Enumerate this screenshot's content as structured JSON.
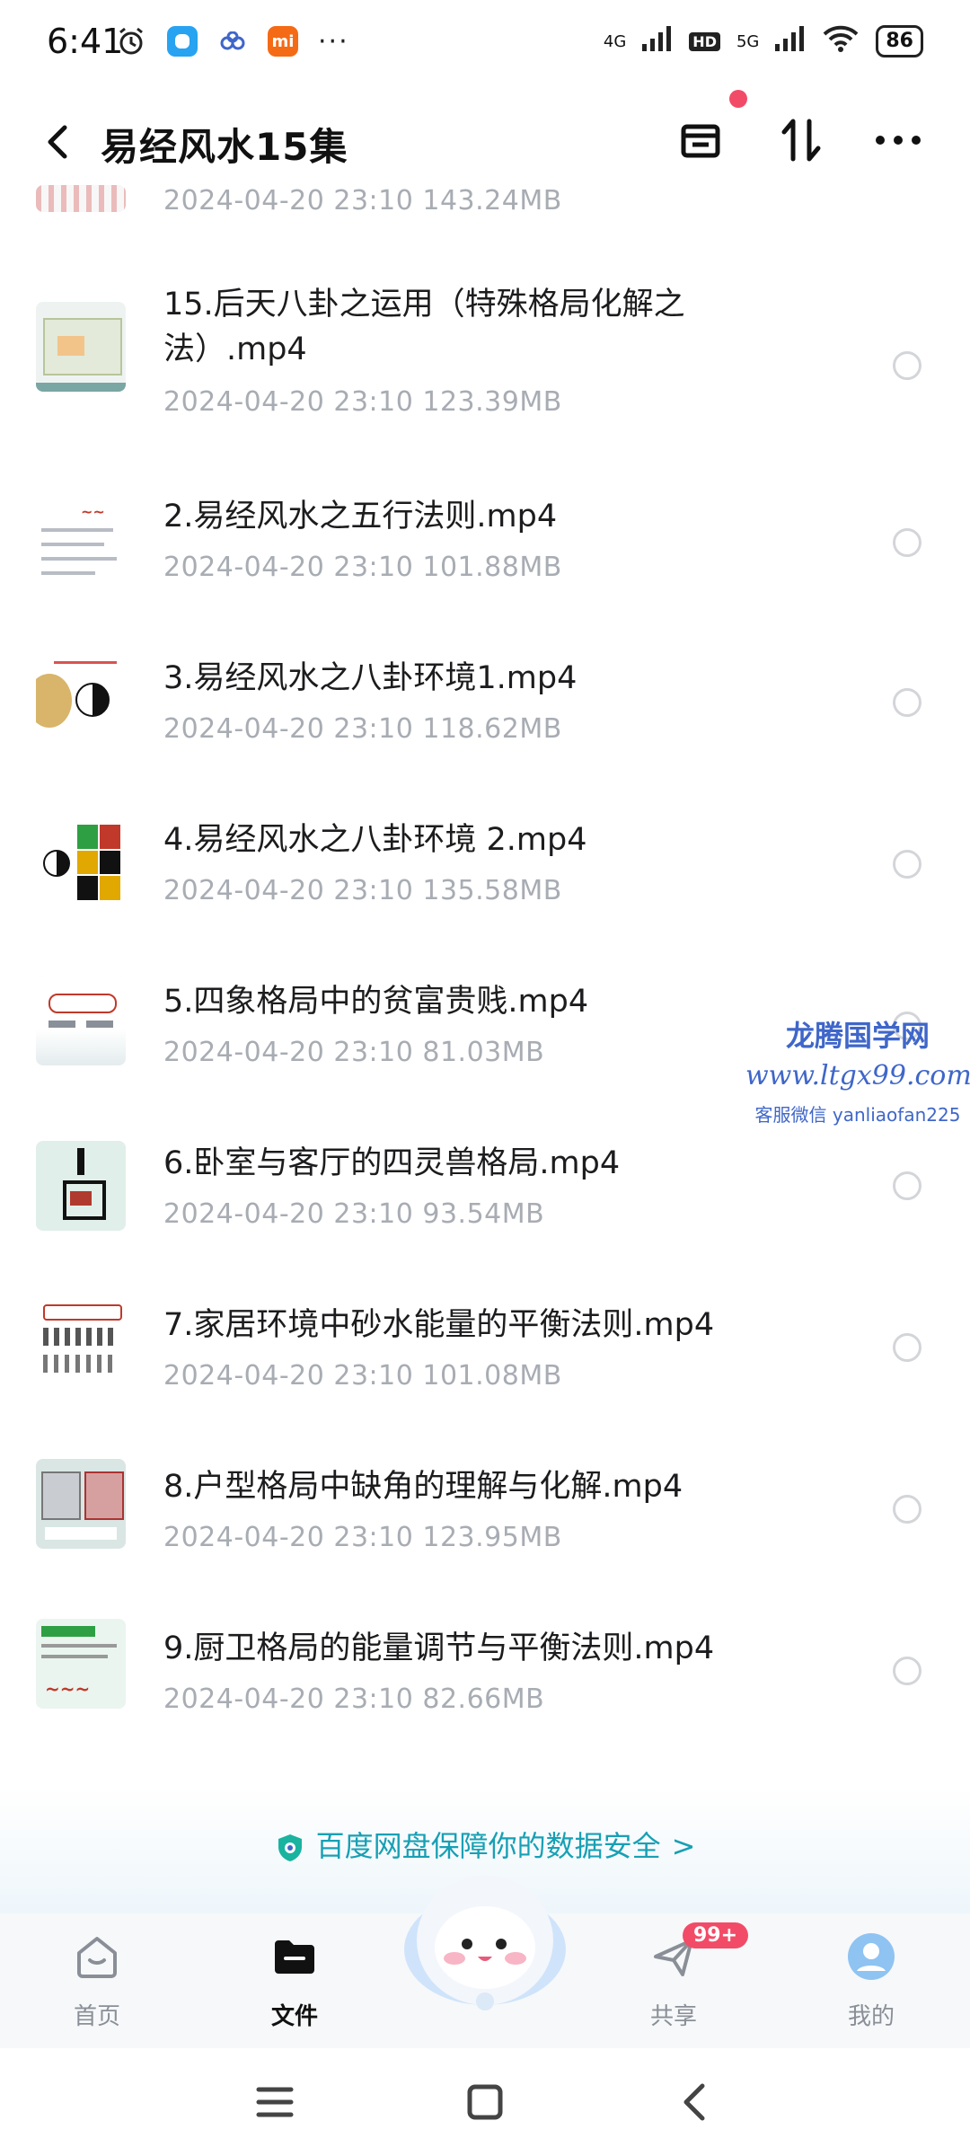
{
  "status_bar": {
    "time": "6:41",
    "network1": "4G",
    "hd": "HD",
    "network2": "5G",
    "battery": "86"
  },
  "header": {
    "title": "易经风水15集",
    "back_icon": "chevron-left-icon",
    "actions": [
      "window-icon",
      "sort-icon",
      "more-icon"
    ]
  },
  "files": [
    {
      "name": "",
      "meta": "2024-04-20  23:10  143.24MB"
    },
    {
      "name": "15.后天八卦之运用（特殊格局化解之法）.mp4",
      "meta": "2024-04-20  23:10  123.39MB"
    },
    {
      "name": "2.易经风水之五行法则.mp4",
      "meta": "2024-04-20  23:10  101.88MB"
    },
    {
      "name": "3.易经风水之八卦环境1.mp4",
      "meta": "2024-04-20  23:10  118.62MB"
    },
    {
      "name": "4.易经风水之八卦环境 2.mp4",
      "meta": "2024-04-20  23:10  135.58MB"
    },
    {
      "name": "5.四象格局中的贫富贵贱.mp4",
      "meta": "2024-04-20  23:10  81.03MB"
    },
    {
      "name": "6.卧室与客厅的四灵兽格局.mp4",
      "meta": "2024-04-20  23:10  93.54MB"
    },
    {
      "name": "7.家居环境中砂水能量的平衡法则.mp4",
      "meta": "2024-04-20  23:10  101.08MB"
    },
    {
      "name": "8.户型格局中缺角的理解与化解.mp4",
      "meta": "2024-04-20  23:10  123.95MB"
    },
    {
      "name": "9.厨卫格局的能量调节与平衡法则.mp4",
      "meta": "2024-04-20  23:10  82.66MB"
    }
  ],
  "watermark": {
    "line1": "龙腾国学网",
    "line2": "www.ltgx99.com",
    "line3": "客服微信 yanliaofan225"
  },
  "banner": {
    "text": "百度网盘保障你的数据安全",
    "arrow": ">"
  },
  "bottom_nav": {
    "items": [
      {
        "label": "首页",
        "icon": "home-icon"
      },
      {
        "label": "文件",
        "icon": "folder-icon"
      },
      {
        "label": "共享",
        "icon": "share-icon"
      },
      {
        "label": "我的",
        "icon": "profile-icon"
      }
    ],
    "badge": "99+"
  },
  "colors": {
    "accent": "#17a0b4",
    "badge": "#f24b67",
    "meta_text": "#a8acb3"
  }
}
